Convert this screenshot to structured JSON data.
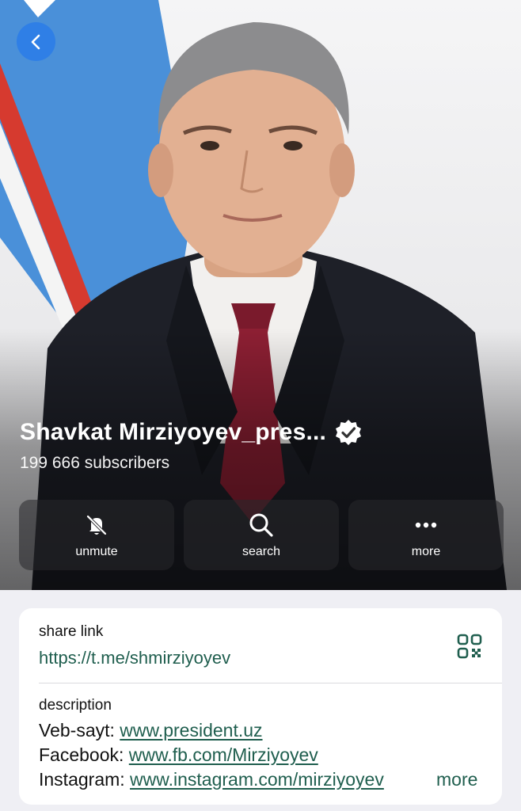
{
  "header": {
    "back_icon": "chevron-left-icon",
    "channel_title": "Shavkat Mirziyoyev_pres...",
    "verified_icon": "verified-badge-icon",
    "subscribers": "199 666 subscribers"
  },
  "actions": [
    {
      "label": "unmute",
      "icon": "bell-muted-icon"
    },
    {
      "label": "search",
      "icon": "search-icon"
    },
    {
      "label": "more",
      "icon": "ellipsis-icon"
    }
  ],
  "info": {
    "share_label": "share link",
    "share_url": "https://t.me/shmirziyoyev",
    "qr_icon": "qr-code-icon",
    "description_label": "description",
    "lines": [
      {
        "prefix": "Veb-sayt: ",
        "link": "www.president.uz"
      },
      {
        "prefix": "Facebook: ",
        "link": "www.fb.com/Mirziyoyev"
      },
      {
        "prefix": "Instagram: ",
        "link": "www.instagram.com/mirziyoyev"
      }
    ],
    "more_label": "more"
  },
  "colors": {
    "accent_blue": "#2f7fe6",
    "link_green": "#1f5e4e",
    "flag_blue": "#4a90d9",
    "flag_red": "#d63a2f"
  }
}
